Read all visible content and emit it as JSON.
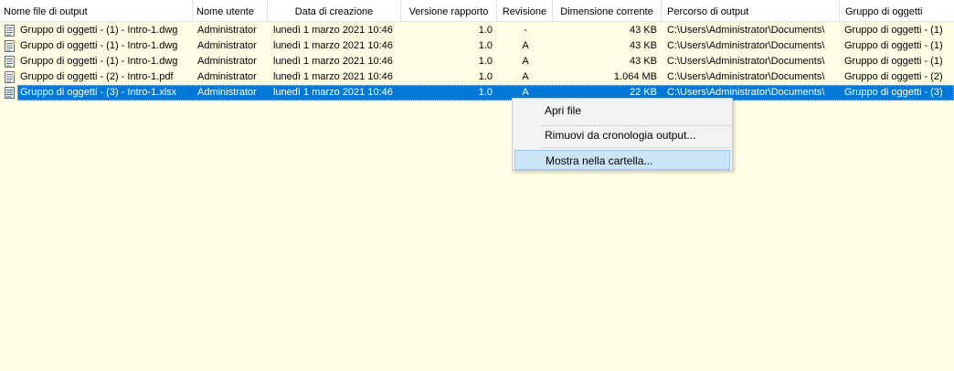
{
  "columns": [
    "Nome file di output",
    "Nome utente",
    "Data di creazione",
    "Versione rapporto",
    "Revisione",
    "Dimensione corrente",
    "Percorso di output",
    "Gruppo di oggetti"
  ],
  "rows": [
    {
      "icon": "dwg-file-icon",
      "name": "Gruppo di oggetti - (1) - Intro-1.dwg",
      "user": "Administrator",
      "date": "lunedì 1 marzo 2021 10:46",
      "version": "1.0",
      "revision": "-",
      "size": "43 KB",
      "path": "C:\\Users\\Administrator\\Documents\\",
      "group": "Gruppo di oggetti - (1)",
      "selected": false
    },
    {
      "icon": "dwg-file-new-icon",
      "name": "Gruppo di oggetti - (1) - Intro-1.dwg",
      "user": "Administrator",
      "date": "lunedì 1 marzo 2021 10:46",
      "version": "1.0",
      "revision": "A",
      "size": "43 KB",
      "path": "C:\\Users\\Administrator\\Documents\\",
      "group": "Gruppo di oggetti - (1)",
      "selected": false
    },
    {
      "icon": "dwg-file-new-icon",
      "name": "Gruppo di oggetti - (1) - Intro-1.dwg",
      "user": "Administrator",
      "date": "lunedì 1 marzo 2021 10:46",
      "version": "1.0",
      "revision": "A",
      "size": "43 KB",
      "path": "C:\\Users\\Administrator\\Documents\\",
      "group": "Gruppo di oggetti - (1)",
      "selected": false
    },
    {
      "icon": "pdf-file-new-icon",
      "name": "Gruppo di oggetti - (2) - Intro-1.pdf",
      "user": "Administrator",
      "date": "lunedì 1 marzo 2021 10:46",
      "version": "1.0",
      "revision": "A",
      "size": "1.064 MB",
      "path": "C:\\Users\\Administrator\\Documents\\",
      "group": "Gruppo di oggetti - (2)",
      "selected": false
    },
    {
      "icon": "xlsx-file-icon",
      "name": "Gruppo di oggetti - (3) - Intro-1.xlsx",
      "user": "Administrator",
      "date": "lunedì 1 marzo 2021 10:46",
      "version": "1.0",
      "revision": "A",
      "size": "22 KB",
      "path": "C:\\Users\\Administrator\\Documents\\",
      "group": "Gruppo di oggetti - (3)",
      "selected": true
    }
  ],
  "context_menu": {
    "open_file": "Apri file",
    "remove_history": "Rimuovi da cronologia output...",
    "show_in_folder": "Mostra nella cartella..."
  },
  "colors": {
    "background": "#fffee4",
    "selection": "#0078d7",
    "menu_highlight": "#cce4f7"
  }
}
